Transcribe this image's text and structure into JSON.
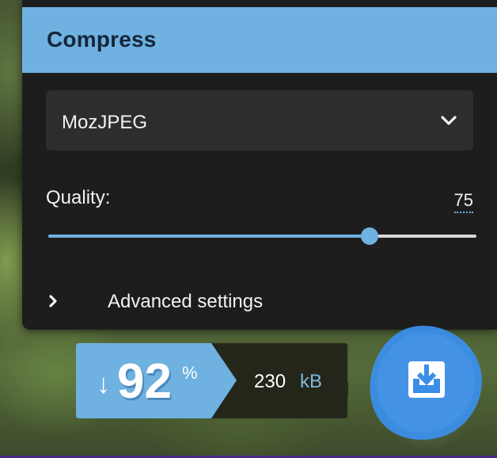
{
  "compress": {
    "title": "Compress",
    "encoder": {
      "selected": "MozJPEG",
      "icon": "chevron-down-icon"
    },
    "quality": {
      "label": "Quality:",
      "value": "75",
      "level": 0.75
    },
    "advanced": {
      "label": "Advanced settings",
      "icon": "chevron-right-icon"
    }
  },
  "results": {
    "arrow": "↓",
    "percent": "92",
    "percent_sign": "%",
    "size_value": "230",
    "size_unit": "kB"
  },
  "download": {
    "icon": "download-icon"
  },
  "colors": {
    "accent": "#6fb1e0",
    "panel": "#1d1d1d",
    "field": "#2d2d2d",
    "download": "#3b8ee8"
  }
}
